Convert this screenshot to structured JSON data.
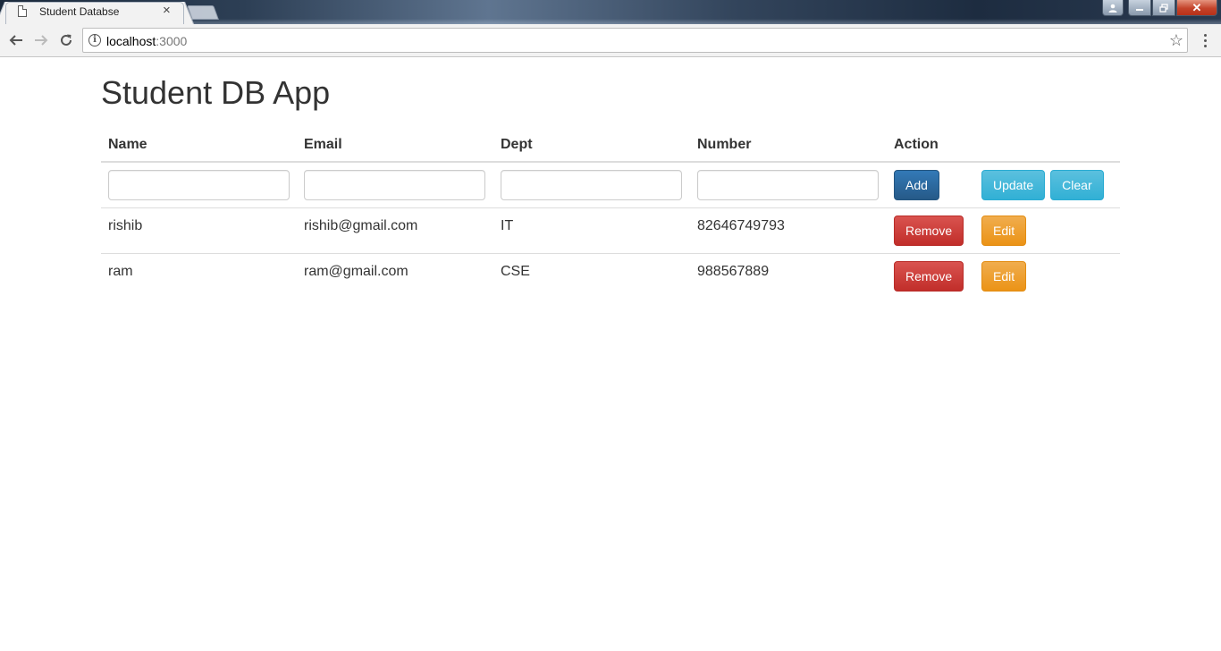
{
  "browser": {
    "tab_title": "Student Databse",
    "url_host": "localhost",
    "url_port": ":3000"
  },
  "page": {
    "title": "Student DB App"
  },
  "table": {
    "headers": [
      "Name",
      "Email",
      "Dept",
      "Number",
      "Action"
    ],
    "input_buttons": {
      "add": "Add",
      "update": "Update",
      "clear": "Clear"
    },
    "rows": [
      {
        "name": "rishib",
        "email": "rishib@gmail.com",
        "dept": "IT",
        "number": "82646749793",
        "remove": "Remove",
        "edit": "Edit"
      },
      {
        "name": "ram",
        "email": "ram@gmail.com",
        "dept": "CSE",
        "number": "988567889",
        "remove": "Remove",
        "edit": "Edit"
      }
    ]
  },
  "colors": {
    "primary": "#337ab7",
    "info": "#5bc0de",
    "danger": "#d9534f",
    "warning": "#f0ad4e"
  },
  "icons": [
    "page-icon",
    "close-icon",
    "back-icon",
    "forward-icon",
    "reload-icon",
    "info-icon",
    "star-icon",
    "menu-icon",
    "profile-icon",
    "minimize-icon",
    "restore-icon",
    "window-close-icon"
  ]
}
